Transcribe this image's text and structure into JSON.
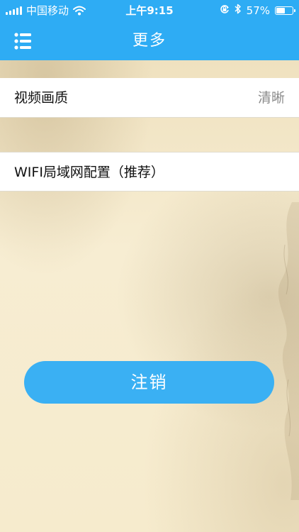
{
  "status_bar": {
    "carrier": "中国移动",
    "time": "上午9:15",
    "battery_percent": "57%",
    "battery_level": 0.57,
    "icons": [
      "signal-icon",
      "wifi-icon",
      "rotation-lock-icon",
      "bluetooth-icon",
      "battery-icon"
    ]
  },
  "nav": {
    "title": "更多",
    "menu_icon": "list-menu-icon"
  },
  "settings": {
    "video_quality_label": "视频画质",
    "video_quality_value": "清晰",
    "wifi_config_label": "WIFI局域网配置（推荐）"
  },
  "actions": {
    "logout_label": "注销"
  },
  "colors": {
    "accent": "#2eacf4",
    "button": "#3ab0f3",
    "background": "#f6ecd1"
  }
}
